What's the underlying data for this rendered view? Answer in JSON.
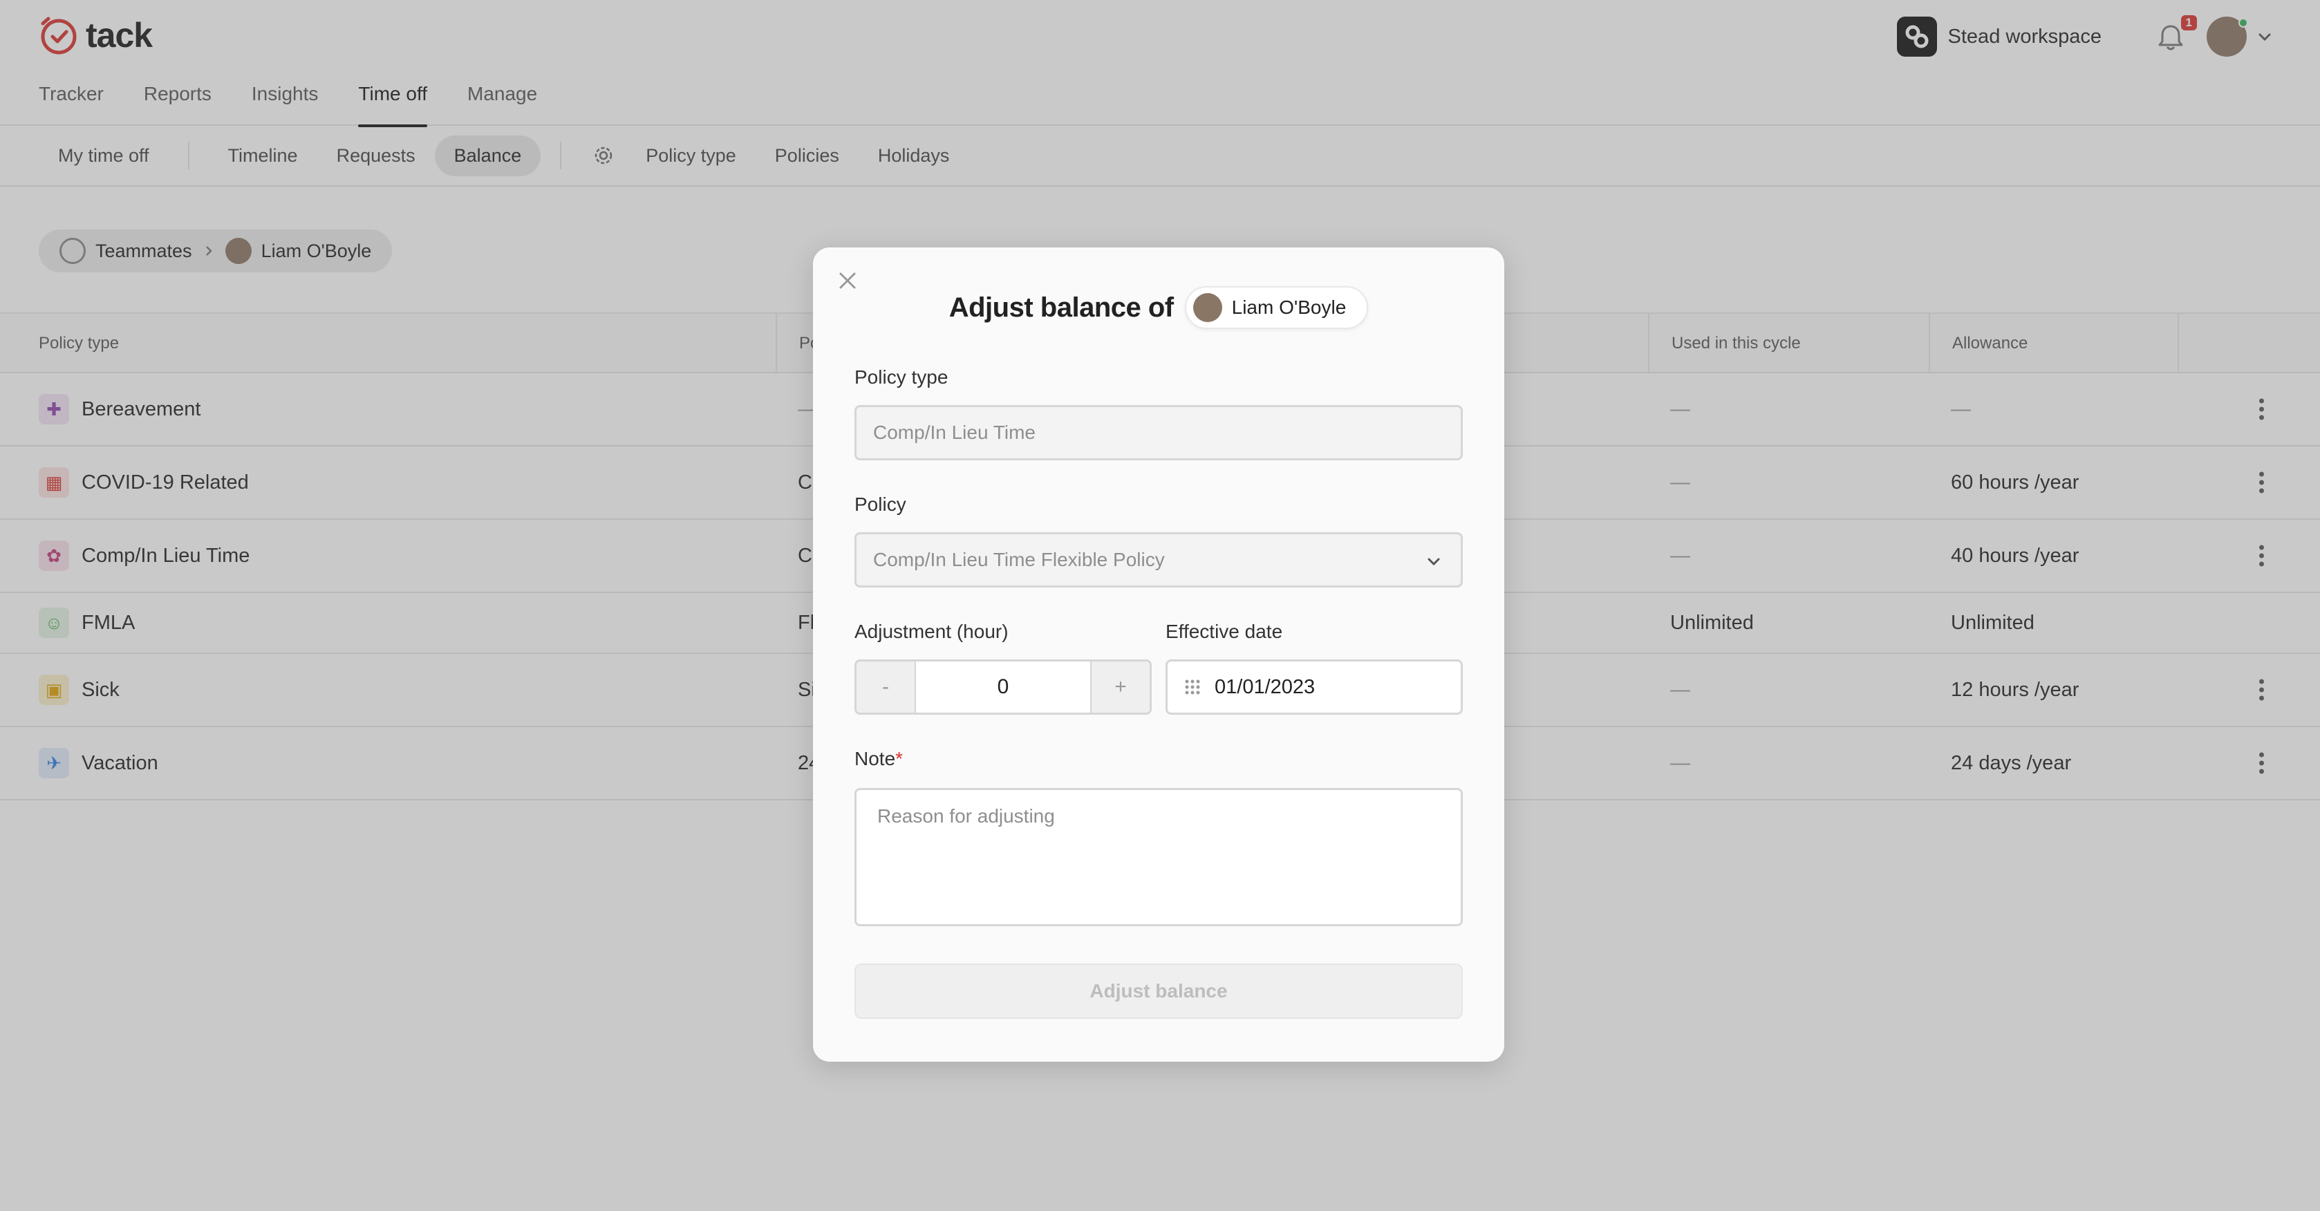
{
  "app": {
    "name": "tack"
  },
  "main_nav": {
    "items": [
      {
        "label": "Tracker",
        "active": false
      },
      {
        "label": "Reports",
        "active": false
      },
      {
        "label": "Insights",
        "active": false
      },
      {
        "label": "Time off",
        "active": true
      },
      {
        "label": "Manage",
        "active": false
      }
    ]
  },
  "header": {
    "workspace_name": "Stead workspace",
    "notification_count": "1"
  },
  "sub_nav": {
    "my_time_off": "My time off",
    "timeline": "Timeline",
    "requests": "Requests",
    "balance": "Balance",
    "policy_type": "Policy type",
    "policies": "Policies",
    "holidays": "Holidays"
  },
  "breadcrumb": {
    "root": "Teammates",
    "current": "Liam O'Boyle"
  },
  "table": {
    "headers": {
      "policy_type": "Policy type",
      "policy": "Po",
      "used_in_cycle": "Used in this cycle",
      "allowance": "Allowance"
    },
    "rows": [
      {
        "name": "Bereavement",
        "icon": "plus-circle-icon",
        "icon_color": "#8e44ad",
        "policy": "—",
        "used": "—",
        "allowance": "—"
      },
      {
        "name": "COVID-19 Related",
        "icon": "store-icon",
        "icon_color": "#d9322d",
        "policy": "C",
        "used": "—",
        "allowance": "60 hours /year"
      },
      {
        "name": "Comp/In Lieu Time",
        "icon": "palette-icon",
        "icon_color": "#c0397a",
        "policy": "C",
        "used": "—",
        "allowance": "40 hours /year"
      },
      {
        "name": "FMLA",
        "icon": "family-icon",
        "icon_color": "#4caf50",
        "policy": "Fl",
        "used": "Unlimited",
        "allowance": "Unlimited"
      },
      {
        "name": "Sick",
        "icon": "clipboard-icon",
        "icon_color": "#e0a100",
        "policy": "Si",
        "used": "—",
        "allowance": "12 hours /year"
      },
      {
        "name": "Vacation",
        "icon": "plane-icon",
        "icon_color": "#2a7be4",
        "policy": "24",
        "used": "—",
        "allowance": "24 days /year"
      }
    ]
  },
  "modal": {
    "title": "Adjust balance of",
    "user_name": "Liam O'Boyle",
    "policy_type_label": "Policy type",
    "policy_type_value": "Comp/In Lieu Time",
    "policy_label": "Policy",
    "policy_value": "Comp/In Lieu Time Flexible Policy",
    "adjustment_label": "Adjustment (hour)",
    "adjustment_minus": "-",
    "adjustment_value": "0",
    "adjustment_plus": "+",
    "effective_date_label": "Effective date",
    "effective_date_value": "01/01/2023",
    "note_label": "Note",
    "note_required_marker": "*",
    "note_placeholder": "Reason for adjusting",
    "submit_label": "Adjust balance"
  },
  "colors": {
    "brand": "#d9322d",
    "overlay": "#646464"
  }
}
